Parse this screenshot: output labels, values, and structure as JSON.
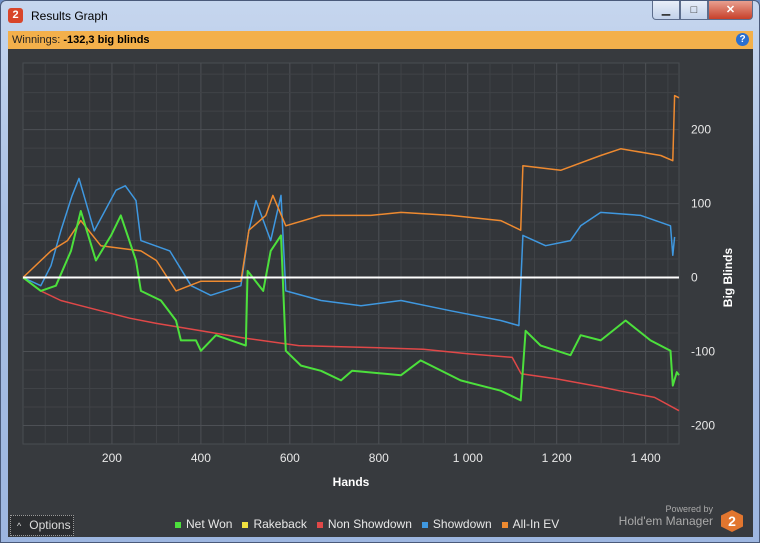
{
  "window": {
    "title": "Results Graph",
    "app_icon": "2"
  },
  "summary": {
    "label": "Winnings:",
    "value": "-132,3 big blinds"
  },
  "chart_data": {
    "type": "line",
    "xlabel": "Hands",
    "ylabel": "Big Blinds",
    "xlim": [
      0,
      1475
    ],
    "ylim": [
      -225,
      290
    ],
    "xticks": [
      {
        "v": 200,
        "label": "200"
      },
      {
        "v": 400,
        "label": "400"
      },
      {
        "v": 600,
        "label": "600"
      },
      {
        "v": 800,
        "label": "800"
      },
      {
        "v": 1000,
        "label": "1 000"
      },
      {
        "v": 1200,
        "label": "1 200"
      },
      {
        "v": 1400,
        "label": "1 400"
      }
    ],
    "yticks": [
      {
        "v": 200,
        "label": "200"
      },
      {
        "v": 100,
        "label": "100"
      },
      {
        "v": 0,
        "label": "0"
      },
      {
        "v": -100,
        "label": "-100"
      },
      {
        "v": -200,
        "label": "-200"
      }
    ],
    "series": [
      {
        "name": "Non Showdown",
        "color": "#e04848",
        "points": [
          [
            0,
            0
          ],
          [
            40,
            -18
          ],
          [
            85,
            -31
          ],
          [
            130,
            -38
          ],
          [
            175,
            -45
          ],
          [
            240,
            -55
          ],
          [
            300,
            -62
          ],
          [
            400,
            -72
          ],
          [
            500,
            -82
          ],
          [
            620,
            -92
          ],
          [
            800,
            -95
          ],
          [
            900,
            -97
          ],
          [
            1000,
            -103
          ],
          [
            1100,
            -108
          ],
          [
            1120,
            -130
          ],
          [
            1200,
            -137
          ],
          [
            1300,
            -148
          ],
          [
            1340,
            -153
          ],
          [
            1420,
            -162
          ],
          [
            1475,
            -180
          ]
        ]
      },
      {
        "name": "Showdown",
        "color": "#3f98e0",
        "points": [
          [
            0,
            0
          ],
          [
            40,
            -11
          ],
          [
            63,
            16
          ],
          [
            85,
            63
          ],
          [
            110,
            110
          ],
          [
            126,
            134
          ],
          [
            160,
            63
          ],
          [
            209,
            118
          ],
          [
            230,
            124
          ],
          [
            254,
            104
          ],
          [
            265,
            50
          ],
          [
            330,
            36
          ],
          [
            378,
            -11
          ],
          [
            422,
            -24
          ],
          [
            490,
            -11
          ],
          [
            508,
            64
          ],
          [
            524,
            104
          ],
          [
            557,
            50
          ],
          [
            580,
            111
          ],
          [
            591,
            -18
          ],
          [
            670,
            -31
          ],
          [
            760,
            -38
          ],
          [
            850,
            -31
          ],
          [
            962,
            -45
          ],
          [
            1074,
            -58
          ],
          [
            1115,
            -65
          ],
          [
            1124,
            57
          ],
          [
            1175,
            43
          ],
          [
            1231,
            50
          ],
          [
            1254,
            70
          ],
          [
            1299,
            88
          ],
          [
            1389,
            84
          ],
          [
            1456,
            70
          ],
          [
            1461,
            30
          ],
          [
            1465,
            55
          ]
        ]
      },
      {
        "name": "All-In EV",
        "color": "#ee8a30",
        "points": [
          [
            0,
            0
          ],
          [
            63,
            36
          ],
          [
            100,
            50
          ],
          [
            130,
            77
          ],
          [
            175,
            43
          ],
          [
            265,
            36
          ],
          [
            300,
            23
          ],
          [
            344,
            -18
          ],
          [
            400,
            -5
          ],
          [
            490,
            -5
          ],
          [
            508,
            64
          ],
          [
            546,
            84
          ],
          [
            562,
            111
          ],
          [
            591,
            70
          ],
          [
            670,
            84
          ],
          [
            782,
            84
          ],
          [
            850,
            88
          ],
          [
            962,
            84
          ],
          [
            1074,
            77
          ],
          [
            1119,
            64
          ],
          [
            1124,
            151
          ],
          [
            1209,
            145
          ],
          [
            1299,
            165
          ],
          [
            1344,
            174
          ],
          [
            1434,
            165
          ],
          [
            1461,
            158
          ],
          [
            1465,
            246
          ],
          [
            1475,
            243
          ]
        ]
      },
      {
        "name": "Net Won",
        "color": "#4ce03c",
        "points": [
          [
            0,
            0
          ],
          [
            40,
            -18
          ],
          [
            74,
            -11
          ],
          [
            108,
            36
          ],
          [
            130,
            90
          ],
          [
            164,
            23
          ],
          [
            198,
            57
          ],
          [
            220,
            84
          ],
          [
            254,
            23
          ],
          [
            265,
            -18
          ],
          [
            310,
            -31
          ],
          [
            344,
            -58
          ],
          [
            355,
            -85
          ],
          [
            389,
            -85
          ],
          [
            400,
            -99
          ],
          [
            434,
            -78
          ],
          [
            501,
            -92
          ],
          [
            505,
            9
          ],
          [
            540,
            -18
          ],
          [
            557,
            36
          ],
          [
            580,
            57
          ],
          [
            591,
            -99
          ],
          [
            625,
            -119
          ],
          [
            670,
            -126
          ],
          [
            715,
            -139
          ],
          [
            740,
            -126
          ],
          [
            850,
            -132
          ],
          [
            894,
            -112
          ],
          [
            984,
            -139
          ],
          [
            1074,
            -153
          ],
          [
            1119,
            -166
          ],
          [
            1130,
            -72
          ],
          [
            1164,
            -92
          ],
          [
            1231,
            -105
          ],
          [
            1254,
            -78
          ],
          [
            1299,
            -85
          ],
          [
            1355,
            -58
          ],
          [
            1411,
            -85
          ],
          [
            1456,
            -99
          ],
          [
            1461,
            -146
          ],
          [
            1470,
            -128
          ],
          [
            1475,
            -132
          ]
        ]
      },
      {
        "name": "Rakeback",
        "color": "#f0e040",
        "points": []
      }
    ],
    "legend_position": "bottom",
    "grid": true
  },
  "legend": [
    {
      "label": "Net Won",
      "color": "#4ce03c"
    },
    {
      "label": "Rakeback",
      "color": "#f0e040"
    },
    {
      "label": "Non Showdown",
      "color": "#e04848"
    },
    {
      "label": "Showdown",
      "color": "#3f98e0"
    },
    {
      "label": "All-In EV",
      "color": "#ee8a30"
    }
  ],
  "footer": {
    "options_label": "Options",
    "options_icon": "^",
    "powered_by": "Powered by",
    "brand": "Hold'em Manager",
    "brand_badge": "2"
  }
}
